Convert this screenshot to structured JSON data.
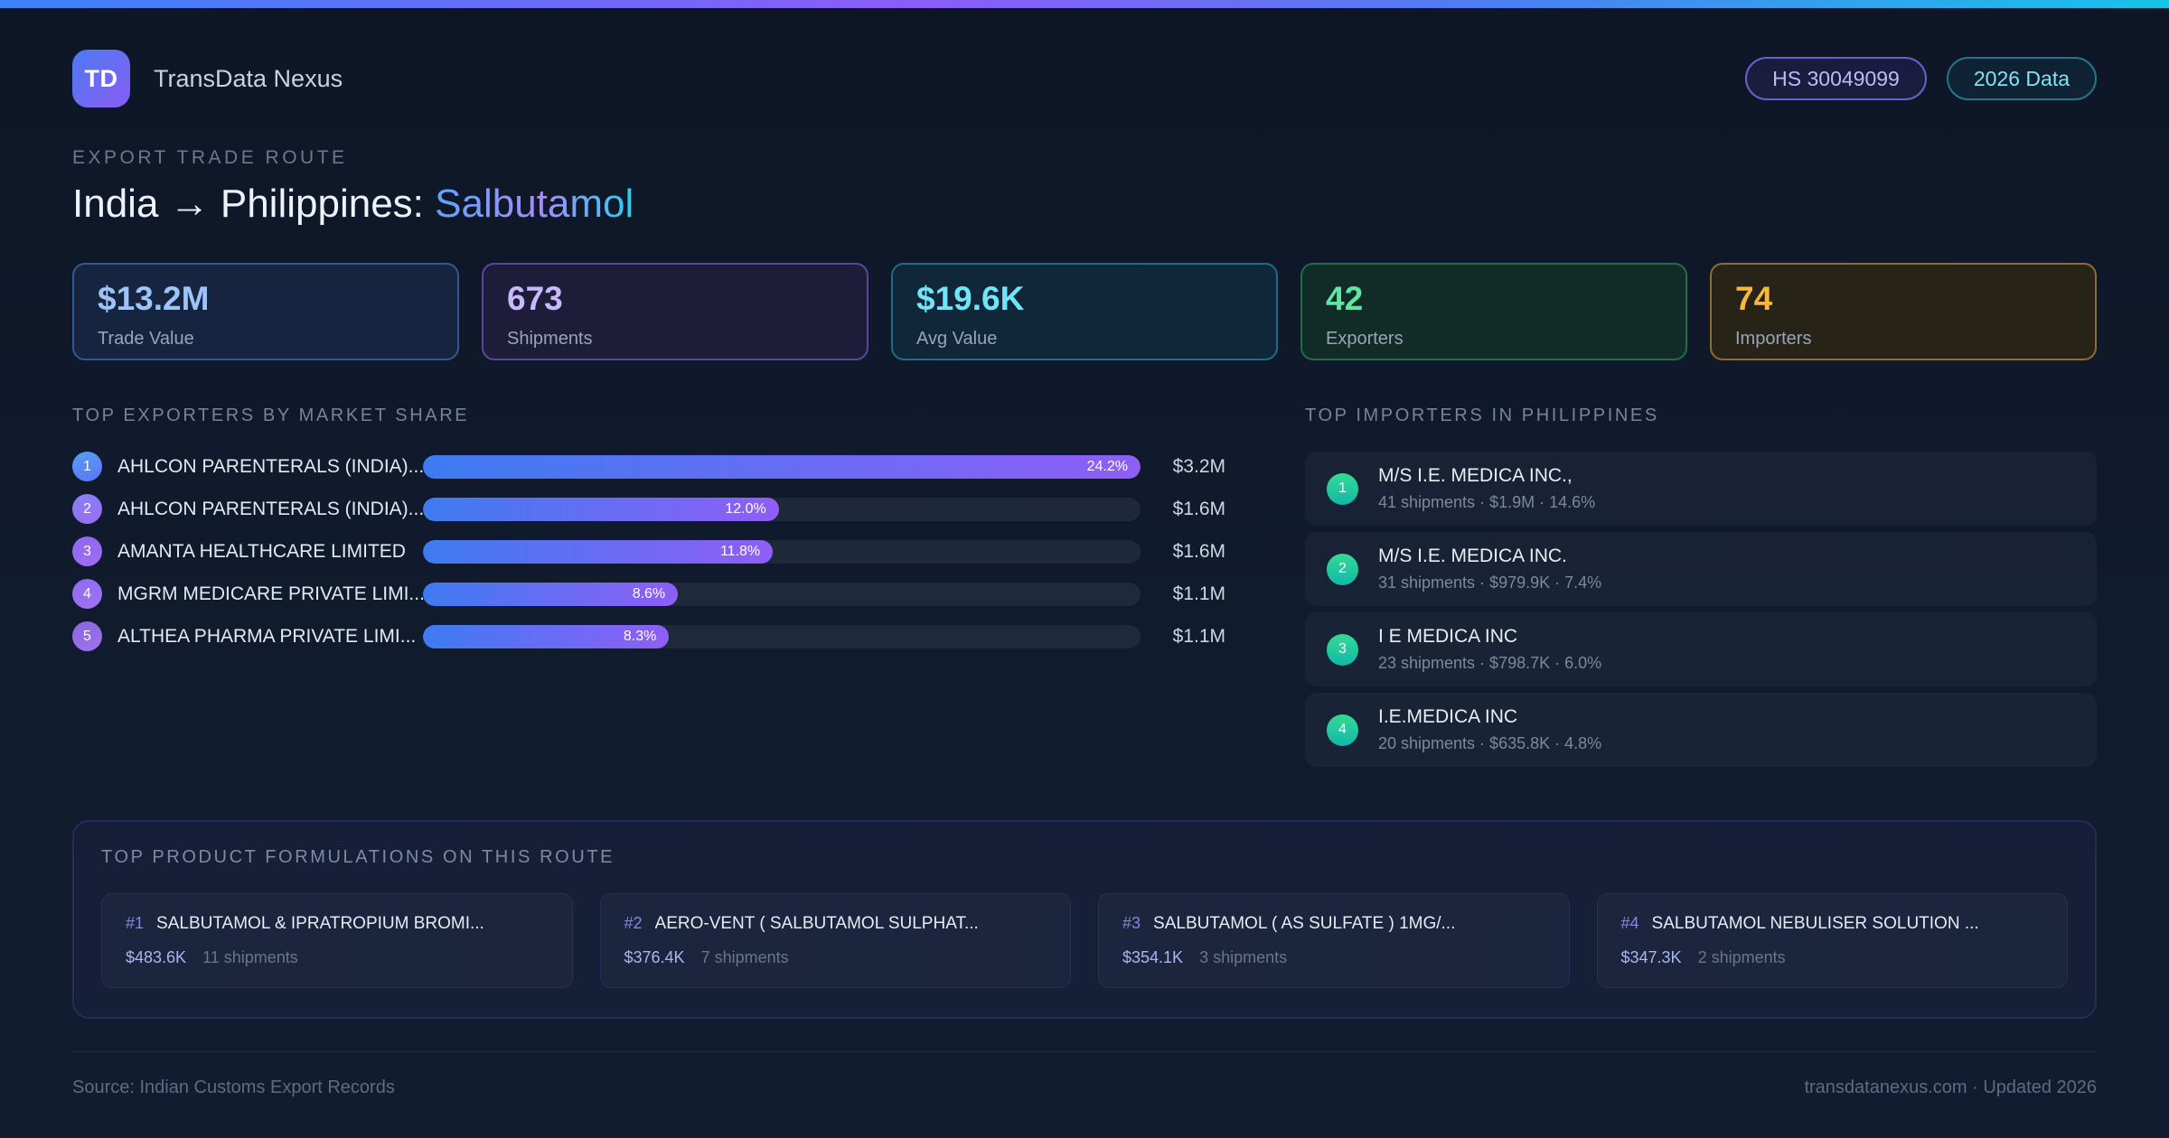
{
  "header": {
    "logo_text": "TD",
    "app_name": "TransData Nexus",
    "badges": [
      {
        "label": "HS 30049099"
      },
      {
        "label": "2026 Data"
      }
    ]
  },
  "hero": {
    "eyebrow": "EXPORT TRADE ROUTE",
    "title_plain": "India → Philippines: ",
    "title_accent": "Salbutamol"
  },
  "stats": [
    {
      "value": "$13.2M",
      "label": "Trade Value"
    },
    {
      "value": "673",
      "label": "Shipments"
    },
    {
      "value": "$19.6K",
      "label": "Avg Value"
    },
    {
      "value": "42",
      "label": "Exporters"
    },
    {
      "value": "74",
      "label": "Importers"
    }
  ],
  "exporters": {
    "heading": "TOP EXPORTERS BY MARKET SHARE",
    "max_share_pct": 24.2,
    "rows": [
      {
        "rank": "1",
        "name": "AHLCON PARENTERALS (INDIA)...",
        "share_pct": 24.2,
        "share_label": "24.2%",
        "value": "$3.2M"
      },
      {
        "rank": "2",
        "name": "AHLCON PARENTERALS (INDIA)...",
        "share_pct": 12.0,
        "share_label": "12.0%",
        "value": "$1.6M"
      },
      {
        "rank": "3",
        "name": "AMANTA HEALTHCARE LIMITED",
        "share_pct": 11.8,
        "share_label": "11.8%",
        "value": "$1.6M"
      },
      {
        "rank": "4",
        "name": "MGRM MEDICARE PRIVATE LIMI...",
        "share_pct": 8.6,
        "share_label": "8.6%",
        "value": "$1.1M"
      },
      {
        "rank": "5",
        "name": "ALTHEA PHARMA PRIVATE LIMI...",
        "share_pct": 8.3,
        "share_label": "8.3%",
        "value": "$1.1M"
      }
    ]
  },
  "importers": {
    "heading": "TOP IMPORTERS IN PHILIPPINES",
    "rows": [
      {
        "rank": "1",
        "name": "M/S I.E. MEDICA INC.,",
        "detail": "41 shipments · $1.9M · 14.6%"
      },
      {
        "rank": "2",
        "name": "M/S I.E. MEDICA INC.",
        "detail": "31 shipments · $979.9K · 7.4%"
      },
      {
        "rank": "3",
        "name": "I E MEDICA INC",
        "detail": "23 shipments · $798.7K · 6.0%"
      },
      {
        "rank": "4",
        "name": "I.E.MEDICA INC",
        "detail": "20 shipments · $635.8K · 4.8%"
      }
    ]
  },
  "formulations": {
    "heading": "TOP PRODUCT FORMULATIONS ON THIS ROUTE",
    "cards": [
      {
        "rank": "#1",
        "name": "SALBUTAMOL & IPRATROPIUM BROMI...",
        "value": "$483.6K",
        "shipments": "11 shipments"
      },
      {
        "rank": "#2",
        "name": "AERO-VENT ( SALBUTAMOL SULPHAT...",
        "value": "$376.4K",
        "shipments": "7 shipments"
      },
      {
        "rank": "#3",
        "name": "SALBUTAMOL ( AS SULFATE ) 1MG/...",
        "value": "$354.1K",
        "shipments": "3 shipments"
      },
      {
        "rank": "#4",
        "name": "SALBUTAMOL NEBULISER SOLUTION ...",
        "value": "$347.3K",
        "shipments": "2 shipments"
      }
    ]
  },
  "footer": {
    "source": "Source: Indian Customs Export Records",
    "meta": "transdatanexus.com · Updated 2026"
  },
  "colors": {
    "accent_blue": "#3b82f6",
    "accent_purple": "#8b5cf6",
    "accent_cyan": "#22d3ee",
    "accent_green": "#34d399",
    "accent_amber": "#f6b83c",
    "background": "#111b2e"
  }
}
